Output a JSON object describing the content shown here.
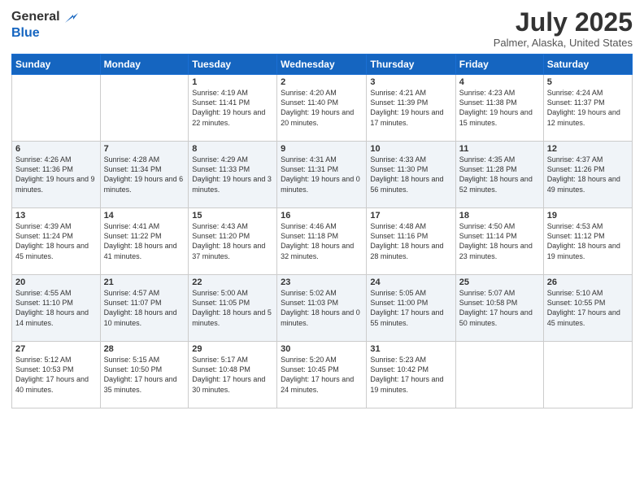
{
  "header": {
    "logo_general": "General",
    "logo_blue": "Blue",
    "title": "July 2025",
    "subtitle": "Palmer, Alaska, United States"
  },
  "weekdays": [
    "Sunday",
    "Monday",
    "Tuesday",
    "Wednesday",
    "Thursday",
    "Friday",
    "Saturday"
  ],
  "weeks": [
    [
      {
        "day": "",
        "info": ""
      },
      {
        "day": "",
        "info": ""
      },
      {
        "day": "1",
        "info": "Sunrise: 4:19 AM\nSunset: 11:41 PM\nDaylight: 19 hours and 22 minutes."
      },
      {
        "day": "2",
        "info": "Sunrise: 4:20 AM\nSunset: 11:40 PM\nDaylight: 19 hours and 20 minutes."
      },
      {
        "day": "3",
        "info": "Sunrise: 4:21 AM\nSunset: 11:39 PM\nDaylight: 19 hours and 17 minutes."
      },
      {
        "day": "4",
        "info": "Sunrise: 4:23 AM\nSunset: 11:38 PM\nDaylight: 19 hours and 15 minutes."
      },
      {
        "day": "5",
        "info": "Sunrise: 4:24 AM\nSunset: 11:37 PM\nDaylight: 19 hours and 12 minutes."
      }
    ],
    [
      {
        "day": "6",
        "info": "Sunrise: 4:26 AM\nSunset: 11:36 PM\nDaylight: 19 hours and 9 minutes."
      },
      {
        "day": "7",
        "info": "Sunrise: 4:28 AM\nSunset: 11:34 PM\nDaylight: 19 hours and 6 minutes."
      },
      {
        "day": "8",
        "info": "Sunrise: 4:29 AM\nSunset: 11:33 PM\nDaylight: 19 hours and 3 minutes."
      },
      {
        "day": "9",
        "info": "Sunrise: 4:31 AM\nSunset: 11:31 PM\nDaylight: 19 hours and 0 minutes."
      },
      {
        "day": "10",
        "info": "Sunrise: 4:33 AM\nSunset: 11:30 PM\nDaylight: 18 hours and 56 minutes."
      },
      {
        "day": "11",
        "info": "Sunrise: 4:35 AM\nSunset: 11:28 PM\nDaylight: 18 hours and 52 minutes."
      },
      {
        "day": "12",
        "info": "Sunrise: 4:37 AM\nSunset: 11:26 PM\nDaylight: 18 hours and 49 minutes."
      }
    ],
    [
      {
        "day": "13",
        "info": "Sunrise: 4:39 AM\nSunset: 11:24 PM\nDaylight: 18 hours and 45 minutes."
      },
      {
        "day": "14",
        "info": "Sunrise: 4:41 AM\nSunset: 11:22 PM\nDaylight: 18 hours and 41 minutes."
      },
      {
        "day": "15",
        "info": "Sunrise: 4:43 AM\nSunset: 11:20 PM\nDaylight: 18 hours and 37 minutes."
      },
      {
        "day": "16",
        "info": "Sunrise: 4:46 AM\nSunset: 11:18 PM\nDaylight: 18 hours and 32 minutes."
      },
      {
        "day": "17",
        "info": "Sunrise: 4:48 AM\nSunset: 11:16 PM\nDaylight: 18 hours and 28 minutes."
      },
      {
        "day": "18",
        "info": "Sunrise: 4:50 AM\nSunset: 11:14 PM\nDaylight: 18 hours and 23 minutes."
      },
      {
        "day": "19",
        "info": "Sunrise: 4:53 AM\nSunset: 11:12 PM\nDaylight: 18 hours and 19 minutes."
      }
    ],
    [
      {
        "day": "20",
        "info": "Sunrise: 4:55 AM\nSunset: 11:10 PM\nDaylight: 18 hours and 14 minutes."
      },
      {
        "day": "21",
        "info": "Sunrise: 4:57 AM\nSunset: 11:07 PM\nDaylight: 18 hours and 10 minutes."
      },
      {
        "day": "22",
        "info": "Sunrise: 5:00 AM\nSunset: 11:05 PM\nDaylight: 18 hours and 5 minutes."
      },
      {
        "day": "23",
        "info": "Sunrise: 5:02 AM\nSunset: 11:03 PM\nDaylight: 18 hours and 0 minutes."
      },
      {
        "day": "24",
        "info": "Sunrise: 5:05 AM\nSunset: 11:00 PM\nDaylight: 17 hours and 55 minutes."
      },
      {
        "day": "25",
        "info": "Sunrise: 5:07 AM\nSunset: 10:58 PM\nDaylight: 17 hours and 50 minutes."
      },
      {
        "day": "26",
        "info": "Sunrise: 5:10 AM\nSunset: 10:55 PM\nDaylight: 17 hours and 45 minutes."
      }
    ],
    [
      {
        "day": "27",
        "info": "Sunrise: 5:12 AM\nSunset: 10:53 PM\nDaylight: 17 hours and 40 minutes."
      },
      {
        "day": "28",
        "info": "Sunrise: 5:15 AM\nSunset: 10:50 PM\nDaylight: 17 hours and 35 minutes."
      },
      {
        "day": "29",
        "info": "Sunrise: 5:17 AM\nSunset: 10:48 PM\nDaylight: 17 hours and 30 minutes."
      },
      {
        "day": "30",
        "info": "Sunrise: 5:20 AM\nSunset: 10:45 PM\nDaylight: 17 hours and 24 minutes."
      },
      {
        "day": "31",
        "info": "Sunrise: 5:23 AM\nSunset: 10:42 PM\nDaylight: 17 hours and 19 minutes."
      },
      {
        "day": "",
        "info": ""
      },
      {
        "day": "",
        "info": ""
      }
    ]
  ]
}
